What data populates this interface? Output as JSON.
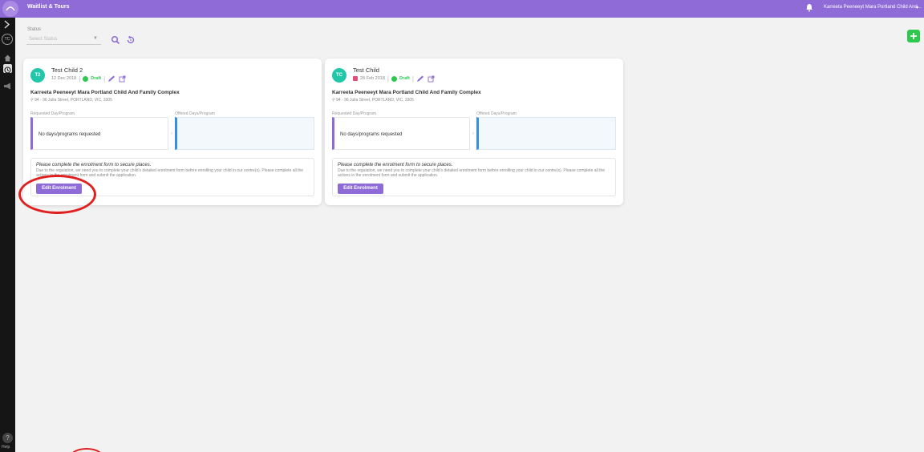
{
  "topbar": {
    "logo_text": "LOGO",
    "app_title": "Waitlist & Tours",
    "user_name": "Karreeta Peeneeyt Mara Portland Child And...",
    "user_caret": "▾"
  },
  "sidebar": {
    "avatar_initials": "TC",
    "help_label": "Help"
  },
  "filter": {
    "status_label": "Status",
    "status_placeholder": "Select Status"
  },
  "cards": [
    {
      "initials": "T2",
      "child_name": "Test Child 2",
      "date": "12 Dec 2018",
      "status": "Draft",
      "centre_name": "Karreeta Peeneeyt Mara Portland Child And Family Complex",
      "address": "94 - 96 Julia Street, PORTLAND, VIC, 3305",
      "requested_label": "Requested Day/Program",
      "offered_label": "Offered Days/Program",
      "requested_text": "No days/programs requested",
      "info_title": "Please complete the enrolment form to secure places.",
      "info_body": "Due to the regulation, we need you to complete your child's detailed enrolment form before enrolling your child in our centre(s). Please complete all the actions in the enrolment form and submit the application.",
      "edit_label": "Edit Enrolment"
    },
    {
      "initials": "TC",
      "child_name": "Test Child",
      "date": "28 Feb 2018",
      "status": "Draft",
      "centre_name": "Karreeta Peeneeyt Mara Portland Child And Family Complex",
      "address": "94 - 96 Julia Street, PORTLAND, VIC, 3305",
      "requested_label": "Requested Day/Program",
      "offered_label": "Offered Days/Program",
      "requested_text": "No days/programs requested",
      "info_title": "Please complete the enrolment form to secure places.",
      "info_body": "Due to the regulation, we need you to complete your child's detailed enrolment form before enrolling your child in our centre(s). Please complete all the actions in the enrolment form and submit the application.",
      "edit_label": "Edit Enrolment"
    }
  ],
  "colors": {
    "brand_purple": "#8e6bd6",
    "avatar_teal": "#22c7a9",
    "draft_green": "#2ec84f",
    "offered_blue": "#3a8fd9",
    "annotation_red": "#e02020"
  },
  "icons": [
    "bell-icon",
    "search-icon",
    "reset-icon",
    "add-icon",
    "calendar-icon",
    "draft-icon",
    "edit-pencil-icon",
    "open-external-icon",
    "location-pin-icon",
    "home-icon",
    "clock-icon",
    "chevron-right-icon"
  ]
}
